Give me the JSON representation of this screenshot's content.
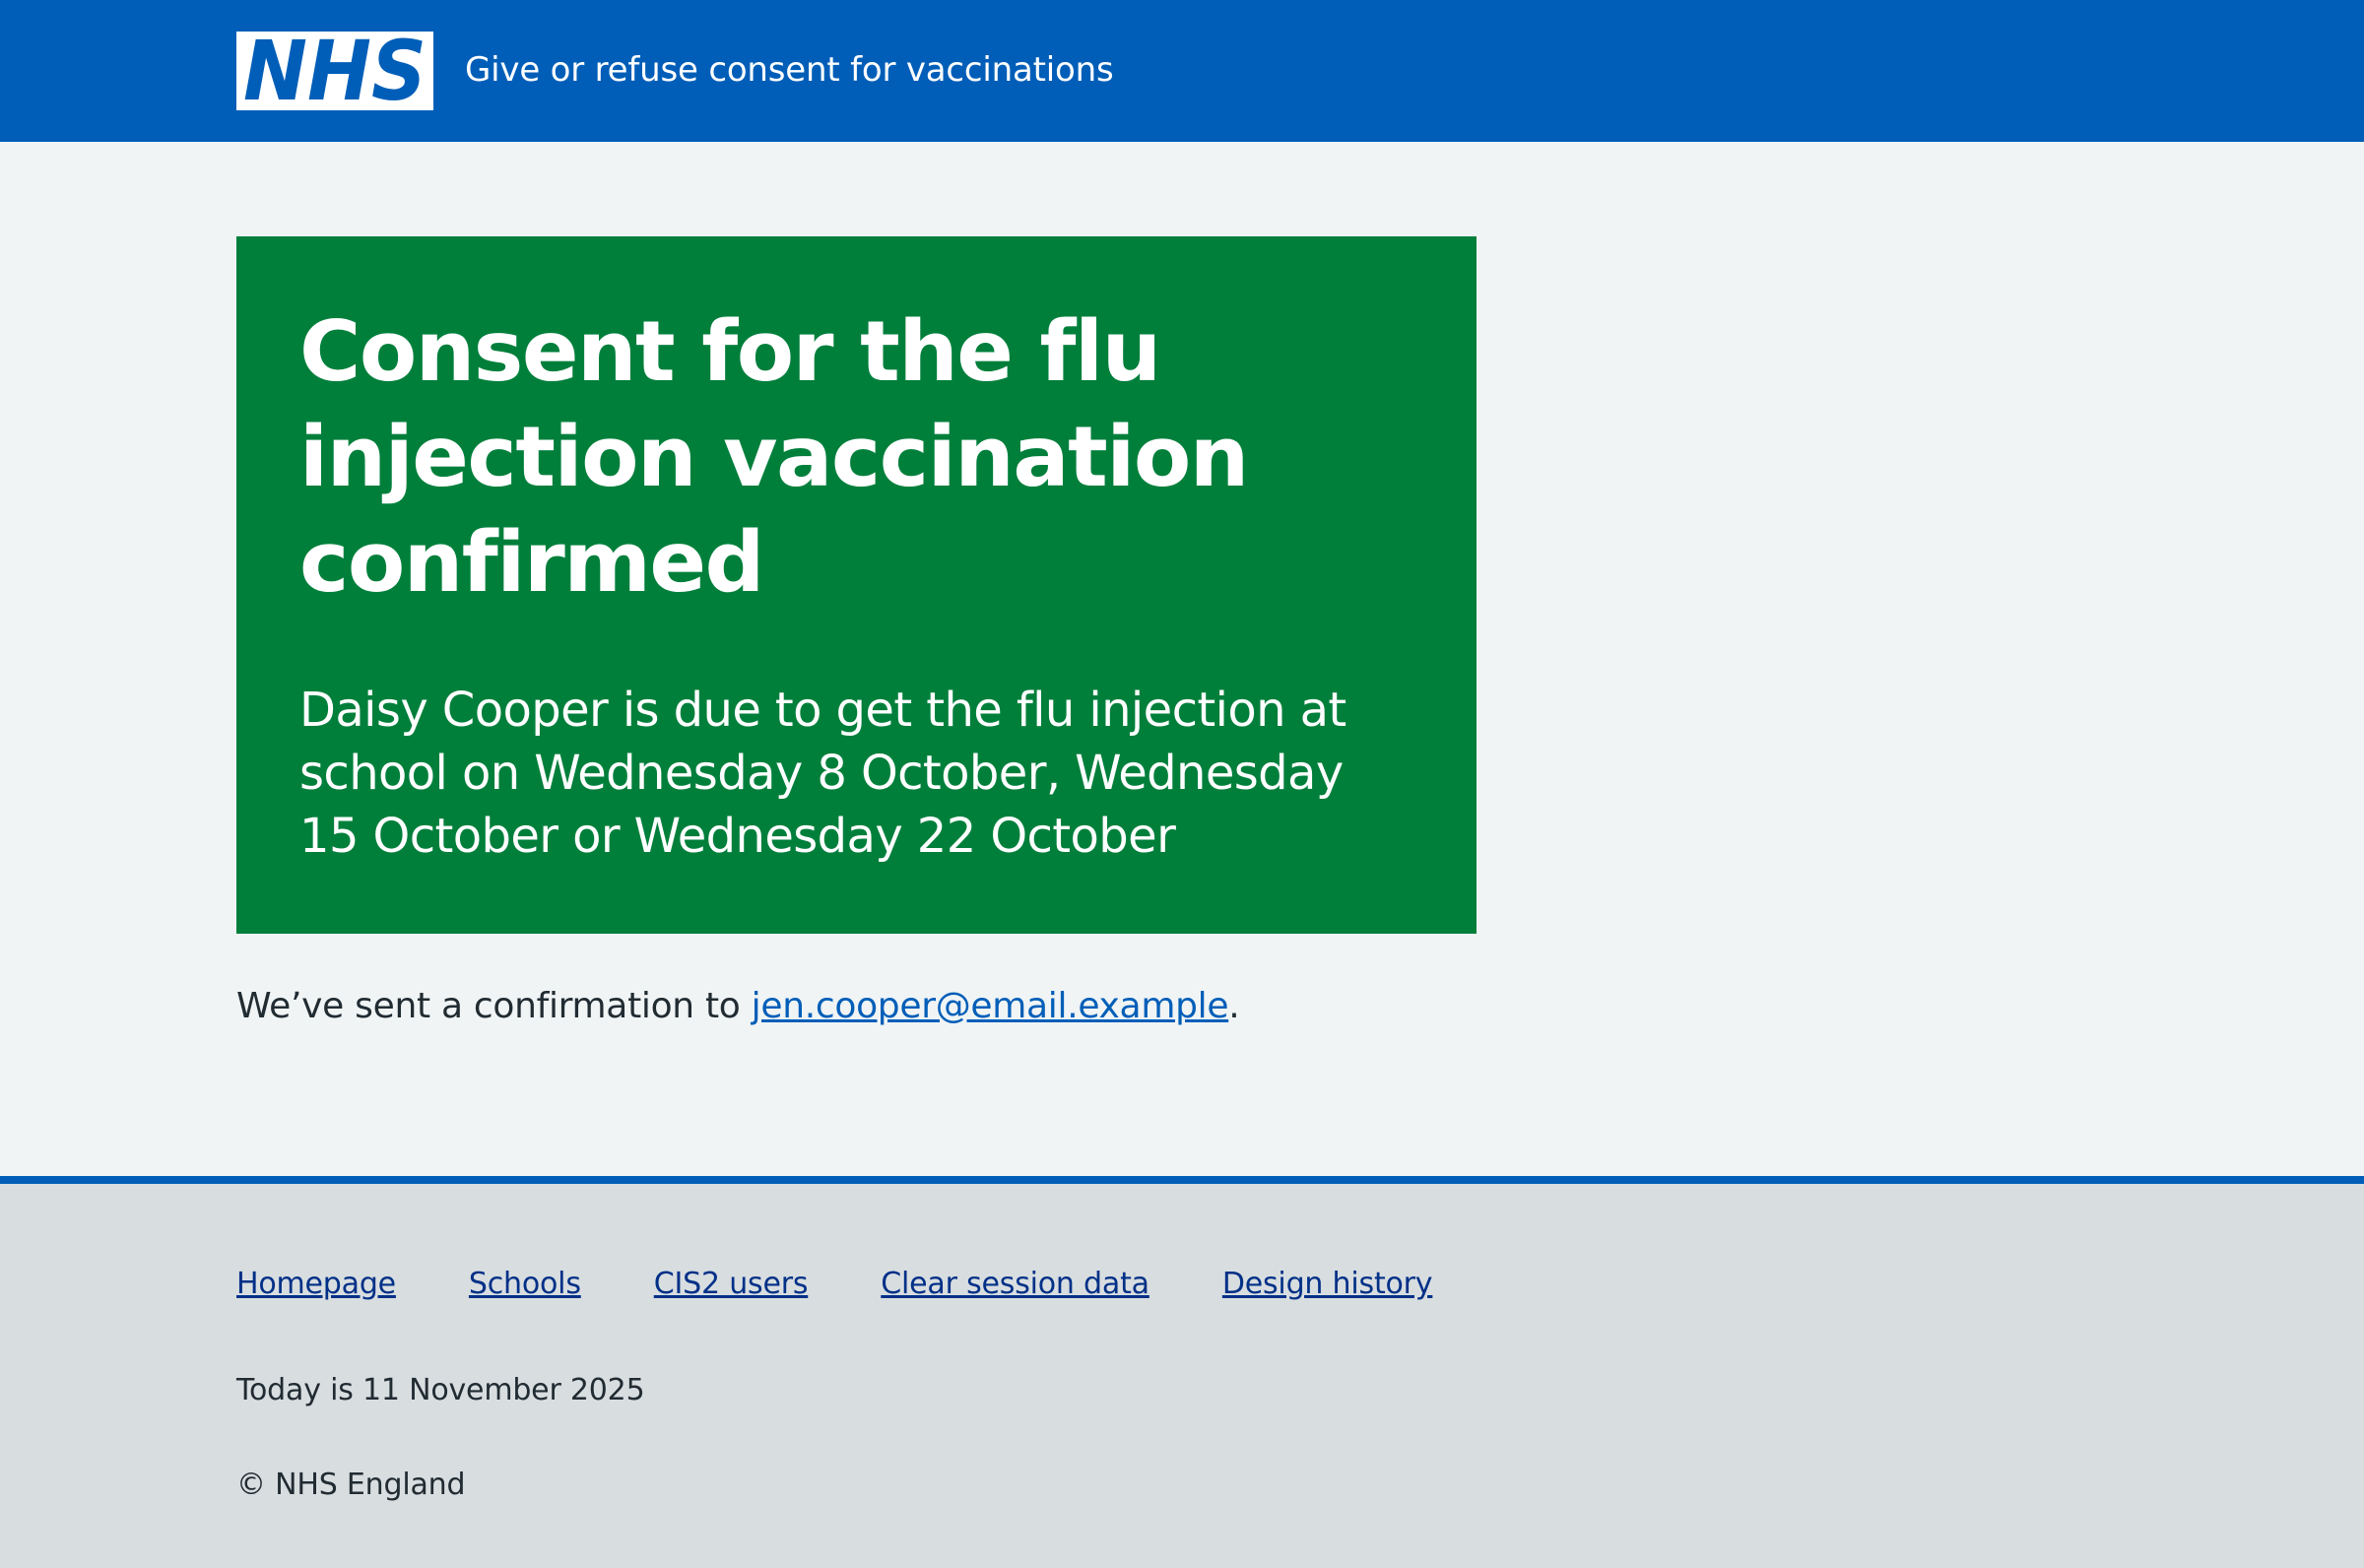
{
  "header": {
    "logo_text": "NHS",
    "service_name": "Give or refuse consent for vaccinations"
  },
  "panel": {
    "title": "Consent for the flu injection vaccination confirmed",
    "body": "Daisy Cooper is due to get the flu injection at school on Wednesday 8 October, Wednesday 15 October or Wednesday 22 October"
  },
  "confirmation": {
    "prefix": "We’ve sent a confirmation to ",
    "email": "jen.cooper@email.example",
    "suffix": "."
  },
  "footer": {
    "links": [
      {
        "label": "Homepage"
      },
      {
        "label": "Schools"
      },
      {
        "label": "CIS2 users"
      },
      {
        "label": "Clear session data"
      },
      {
        "label": "Design history"
      }
    ],
    "date_text": "Today is 11 November 2025",
    "copyright": "© NHS England"
  },
  "colors": {
    "nhs_blue": "#005eb8",
    "success_green": "#007f3b",
    "page_background": "#f0f4f5",
    "footer_background": "#d8dde0",
    "footer_link": "#003087",
    "text": "#212b32"
  }
}
